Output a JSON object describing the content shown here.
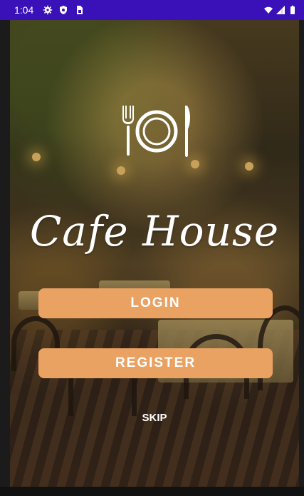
{
  "status_bar": {
    "time": "1:04"
  },
  "app": {
    "title": "Cafe House",
    "buttons": {
      "login": "LOGIN",
      "register": "REGISTER",
      "skip": "SKIP"
    }
  },
  "colors": {
    "status_bar": "#3a11b8",
    "button": "#eaa263",
    "text": "#ffffff"
  },
  "icons": {
    "logo": "fork-plate-knife-icon"
  }
}
